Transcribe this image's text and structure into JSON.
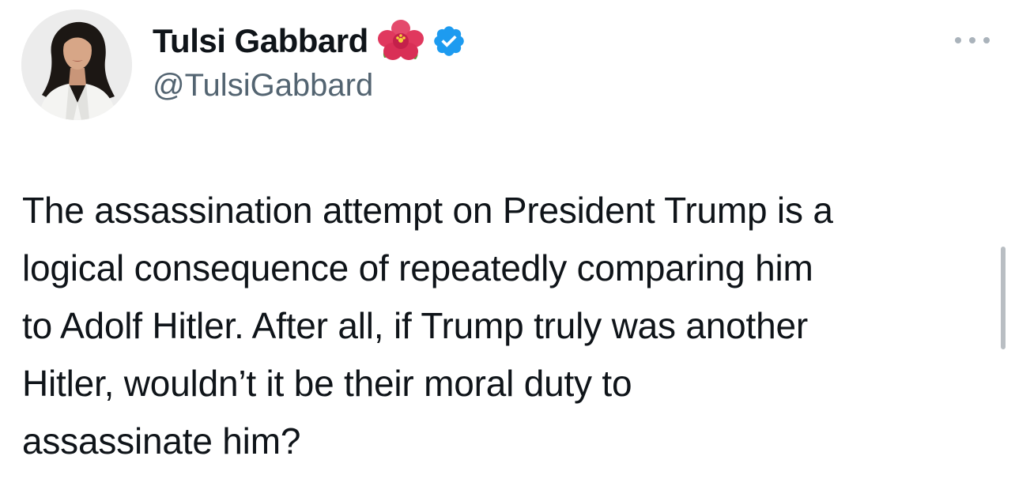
{
  "tweet": {
    "author": {
      "display_name": "Tulsi Gabbard",
      "handle": "@TulsiGabbard",
      "emoji_icon": "hibiscus-flower-icon",
      "verified_icon": "verified-badge-icon",
      "verified_color": "#1d9bf0"
    },
    "text": "The assassination attempt on President Trump is a\nlogical consequence of repeatedly comparing him\nto Adolf Hitler. After all, if Trump truly was another\nHitler, wouldn’t it be their moral duty to\nassassinate him?",
    "more_icon": "more-options-icon"
  },
  "colors": {
    "text_primary": "#0f1419",
    "text_secondary": "#536471",
    "background": "#ffffff"
  }
}
